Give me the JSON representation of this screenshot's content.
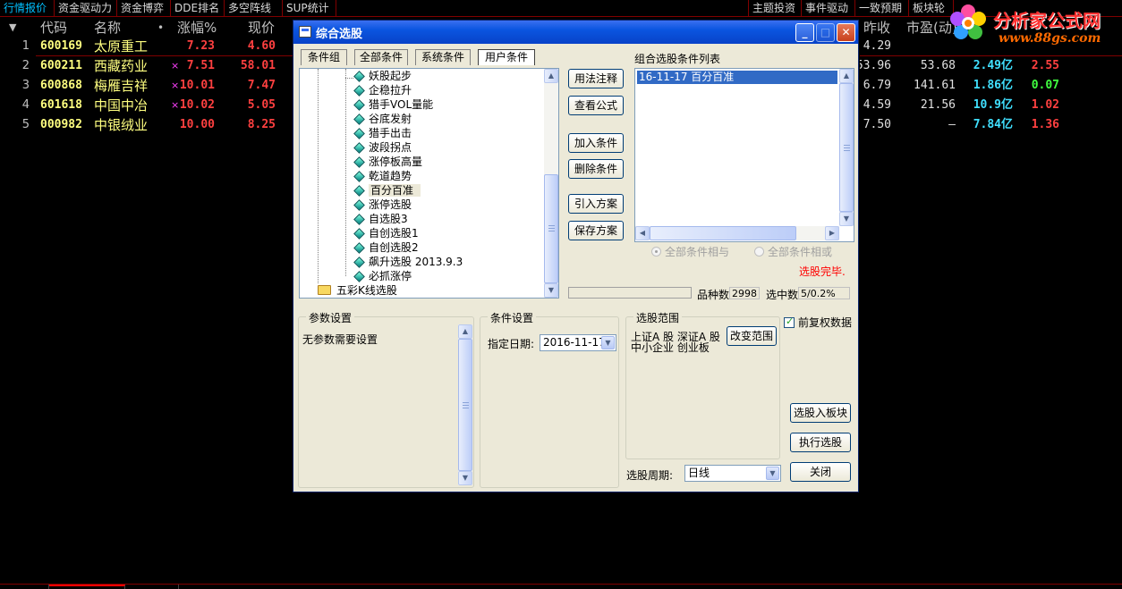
{
  "menu": {
    "tabs_left": [
      "行情报价",
      "资金驱动力",
      "资金博弈",
      "DDE排名",
      "多空阵线",
      "SUP统计"
    ],
    "tabs_right": [
      "主题投资",
      "事件驱动",
      "一致预期",
      "板块轮"
    ]
  },
  "logo": {
    "title": "分析家公式网",
    "url": "www.88gs.com"
  },
  "quote_table": {
    "headers": {
      "code": "代码",
      "name": "名称",
      "dot": "•",
      "change": "涨幅%",
      "price": "现价",
      "prev_close": "昨收",
      "pe": "市盈(动)"
    },
    "rows": [
      {
        "num": "1",
        "code": "600169",
        "name": "太原重工",
        "mark": "",
        "change": "7.23",
        "price": "4.60",
        "prev_close": "4.29",
        "pe": "",
        "c1": "",
        "c2": ""
      },
      {
        "num": "2",
        "code": "600211",
        "name": "西藏药业",
        "mark": "×",
        "change": "7.51",
        "price": "58.01",
        "prev_close": "53.96",
        "pe": "53.68",
        "c1": "2.49亿",
        "c2": "2.55"
      },
      {
        "num": "3",
        "code": "600868",
        "name": "梅雁吉祥",
        "mark": "×",
        "change": "10.01",
        "price": "7.47",
        "prev_close": "6.79",
        "pe": "141.61",
        "c1": "1.86亿",
        "c2": "0.07"
      },
      {
        "num": "4",
        "code": "601618",
        "name": "中国中冶",
        "mark": "×",
        "change": "10.02",
        "price": "5.05",
        "prev_close": "4.59",
        "pe": "21.56",
        "c1": "10.9亿",
        "c2": "1.02"
      },
      {
        "num": "5",
        "code": "000982",
        "name": "中银绒业",
        "mark": "",
        "change": "10.00",
        "price": "8.25",
        "prev_close": "7.50",
        "pe": "–",
        "c1": "7.84亿",
        "c2": "1.36"
      }
    ]
  },
  "dialog": {
    "title": "综合选股",
    "title_buttons": {
      "min": "_",
      "max": "□",
      "close": "✕"
    },
    "tabs": [
      "条件组",
      "全部条件",
      "系统条件",
      "用户条件"
    ],
    "tree_items": [
      "妖股起步",
      "企稳拉升",
      "猎手VOL量能",
      "谷底发射",
      "猎手出击",
      "波段拐点",
      "涨停板高量",
      "乾道趋势",
      "百分百准",
      "涨停选股",
      "自选股3",
      "自创选股1",
      "自创选股2",
      "飙升选股 2013.9.3",
      "必抓涨停"
    ],
    "tree_folder": "五彩K线选股",
    "buttons": {
      "usage": "用法注释",
      "view_formula": "查看公式",
      "add": "加入条件",
      "delete": "删除条件",
      "import": "引入方案",
      "save": "保存方案",
      "to_block": "选股入板块",
      "execute": "执行选股",
      "close": "关闭",
      "change_range": "改变范围"
    },
    "cond_list_title": "组合选股条件列表",
    "cond_items": [
      "16-11-17 百分百准"
    ],
    "radio_and": "全部条件相与",
    "radio_or": "全部条件相或",
    "status": "选股完毕.",
    "count_label": "品种数",
    "count_value": "2998",
    "selected_label": "选中数",
    "selected_value": "5/0.2%",
    "param_group": "参数设置",
    "param_text": "无参数需要设置",
    "cond_group": "条件设置",
    "date_label": "指定日期:",
    "date_value": "2016-11-17",
    "range_group": "选股范围",
    "range_line1": "上证A 股  深证A 股",
    "range_line2": "中小企业  创业板",
    "adjust_label": "前复权数据",
    "period_label": "选股周期:",
    "period_value": "日线"
  }
}
